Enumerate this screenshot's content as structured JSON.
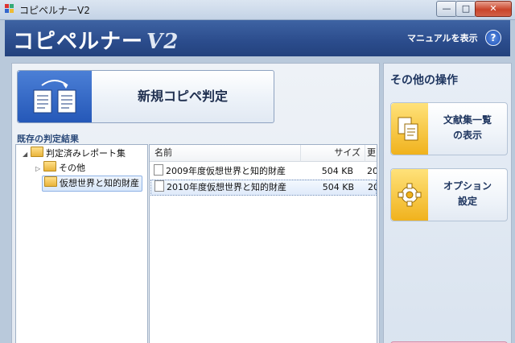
{
  "window": {
    "title": "コピペルナーV2",
    "controls": {
      "minimize": "—",
      "maximize": "□",
      "close": "✕"
    }
  },
  "header": {
    "logo_main": "コピペルナー",
    "logo_version": "V2",
    "manual_label": "マニュアルを表示",
    "help_glyph": "?"
  },
  "main": {
    "new_check_label": "新規コピペ判定",
    "results_section_label": "既存の判定結果",
    "tree": [
      {
        "label": "判定済みレポート集",
        "expander": "◢"
      },
      {
        "label": "その他",
        "expander": "▷"
      },
      {
        "label": "仮想世界と知的財産",
        "expander": ""
      }
    ],
    "file_columns": [
      "名前",
      "サイズ",
      "更"
    ],
    "files": [
      {
        "name": "2009年度仮想世界と知的財産",
        "size": "504 KB",
        "date": "20"
      },
      {
        "name": "2010年度仮想世界と知的財産",
        "size": "504 KB",
        "date": "20"
      }
    ]
  },
  "sidebar": {
    "title": "その他の操作",
    "buttons": [
      {
        "line1": "文献集一覧",
        "line2": "の表示",
        "icon": "documents-icon"
      },
      {
        "line1": "オプション",
        "line2": "設定",
        "icon": "gear-icon"
      }
    ]
  }
}
